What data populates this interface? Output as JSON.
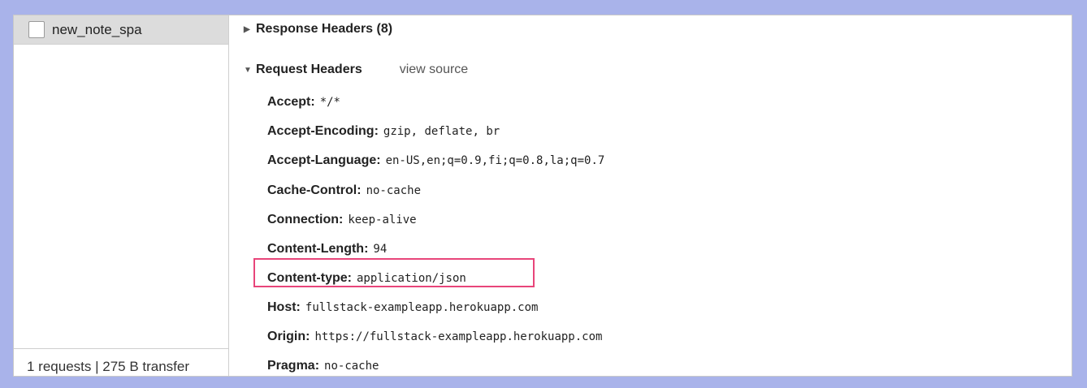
{
  "request_list": {
    "items": [
      {
        "name": "new_note_spa"
      }
    ],
    "footer": "1 requests | 275 B transfer"
  },
  "headers_panel": {
    "response_headers": {
      "label": "Response Headers (8)",
      "expanded": false
    },
    "request_headers": {
      "label": "Request Headers",
      "view_source": "view source",
      "expanded": true,
      "items": [
        {
          "key": "Accept:",
          "value": "*/*"
        },
        {
          "key": "Accept-Encoding:",
          "value": "gzip, deflate, br"
        },
        {
          "key": "Accept-Language:",
          "value": "en-US,en;q=0.9,fi;q=0.8,la;q=0.7"
        },
        {
          "key": "Cache-Control:",
          "value": "no-cache"
        },
        {
          "key": "Connection:",
          "value": "keep-alive"
        },
        {
          "key": "Content-Length:",
          "value": "94"
        },
        {
          "key": "Content-type:",
          "value": "application/json",
          "highlighted": true
        },
        {
          "key": "Host:",
          "value": "fullstack-exampleapp.herokuapp.com"
        },
        {
          "key": "Origin:",
          "value": "https://fullstack-exampleapp.herokuapp.com"
        },
        {
          "key": "Pragma:",
          "value": "no-cache"
        }
      ]
    }
  },
  "colors": {
    "page_background": "#a9b3ea",
    "highlight_border": "#e8457a",
    "selected_row": "#dcdcdc"
  }
}
